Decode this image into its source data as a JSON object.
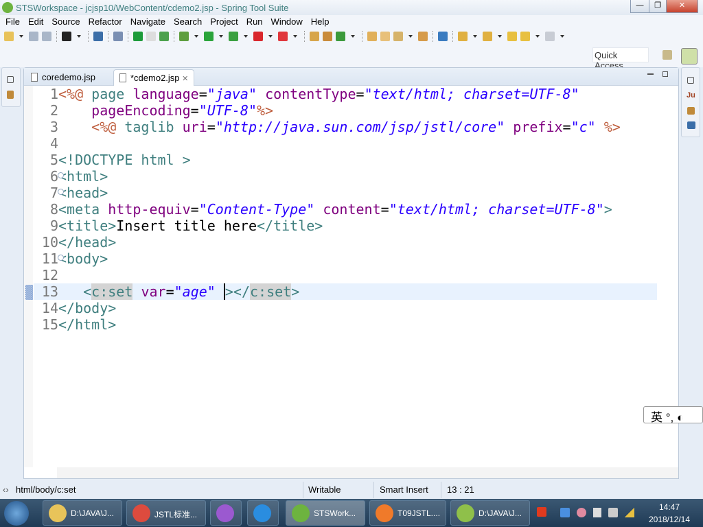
{
  "window": {
    "title": "STSWorkspace - jcjsp10/WebContent/cdemo2.jsp - Spring Tool Suite",
    "minimize": "—",
    "restore": "❐",
    "close": "✕"
  },
  "menu": [
    "File",
    "Edit",
    "Source",
    "Refactor",
    "Navigate",
    "Search",
    "Project",
    "Run",
    "Window",
    "Help"
  ],
  "toolbar": {
    "icons": [
      {
        "name": "new-icon",
        "color": "#e8c25a",
        "dd": true
      },
      {
        "name": "save-icon",
        "color": "#a9b6c8"
      },
      {
        "name": "save-all-icon",
        "color": "#a9b6c8",
        "sep": true
      },
      {
        "name": "profile-icon",
        "color": "#222",
        "dd": true,
        "sep": true
      },
      {
        "name": "terminal-icon",
        "color": "#3b6ea8",
        "sep": true
      },
      {
        "name": "skip-breakpoints-icon",
        "color": "#7a8fb3",
        "sep": true
      },
      {
        "name": "spring-boot-icon",
        "color": "#1d9b3a"
      },
      {
        "name": "toggle-icon",
        "color": "#ddd"
      },
      {
        "name": "spring-dashboard-icon",
        "color": "#4ca14c",
        "sep": true
      },
      {
        "name": "debug-icon",
        "color": "#5e9e3e",
        "dd": true
      },
      {
        "name": "run-icon",
        "color": "#2aa43a",
        "dd": true
      },
      {
        "name": "run-server-icon",
        "color": "#3aa040",
        "dd": true
      },
      {
        "name": "stop-icon",
        "color": "#d9262c",
        "dd": true
      },
      {
        "name": "external-tools-icon",
        "color": "#e0363c",
        "dd": true,
        "sep": true
      },
      {
        "name": "new-aspect-icon",
        "color": "#d7a54a"
      },
      {
        "name": "new-type-icon",
        "color": "#c98b3a"
      },
      {
        "name": "new-class-icon",
        "color": "#3b9a3b",
        "dd": true,
        "sep": true
      },
      {
        "name": "open-project-icon",
        "color": "#e1b05a"
      },
      {
        "name": "open-folder-icon",
        "color": "#e8c07a"
      },
      {
        "name": "pen-icon",
        "color": "#d6b36a",
        "dd": true
      },
      {
        "name": "open-resource-icon",
        "color": "#d69b4a",
        "sep": true
      },
      {
        "name": "globe-icon",
        "color": "#3a7bc0",
        "sep": true
      },
      {
        "name": "next-annotation-icon",
        "color": "#e0b040",
        "dd": true
      },
      {
        "name": "prev-annotation-icon",
        "color": "#e0b040",
        "dd": true
      },
      {
        "name": "last-edit-icon",
        "color": "#e8c040"
      },
      {
        "name": "back-icon",
        "color": "#e8c040",
        "dd": true
      },
      {
        "name": "forward-icon",
        "color": "#c8ccd4",
        "dd": true
      }
    ]
  },
  "quick_access": {
    "placeholder": "Quick Access"
  },
  "editor": {
    "tabs": [
      {
        "label": "coredemo.jsp",
        "active": false
      },
      {
        "label": "*cdemo2.jsp",
        "active": true,
        "close": "✕"
      }
    ],
    "current_line": 13,
    "lines": [
      {
        "n": "1",
        "tokens": [
          [
            "j",
            "<%@ "
          ],
          [
            "t",
            "page "
          ],
          [
            "a",
            "language"
          ],
          [
            "x",
            "="
          ],
          [
            "v",
            "\"java\""
          ],
          [
            "x",
            " "
          ],
          [
            "a",
            "contentType"
          ],
          [
            "x",
            "="
          ],
          [
            "v",
            "\"text/html; charset=UTF-8\""
          ]
        ]
      },
      {
        "n": "2",
        "tokens": [
          [
            "x",
            "    "
          ],
          [
            "a",
            "pageEncoding"
          ],
          [
            "x",
            "="
          ],
          [
            "v",
            "\"UTF-8\""
          ],
          [
            "j",
            "%>"
          ]
        ]
      },
      {
        "n": "3",
        "tokens": [
          [
            "x",
            "    "
          ],
          [
            "j",
            "<%@ "
          ],
          [
            "t",
            "taglib "
          ],
          [
            "a",
            "uri"
          ],
          [
            "x",
            "="
          ],
          [
            "v",
            "\"http://java.sun.com/jsp/jstl/core\""
          ],
          [
            "x",
            " "
          ],
          [
            "a",
            "prefix"
          ],
          [
            "x",
            "="
          ],
          [
            "v",
            "\"c\""
          ],
          [
            "x",
            " "
          ],
          [
            "j",
            "%>"
          ]
        ]
      },
      {
        "n": "4",
        "tokens": []
      },
      {
        "n": "5",
        "tokens": [
          [
            "t",
            "<!DOCTYPE html >"
          ]
        ]
      },
      {
        "n": "6",
        "fold": true,
        "tokens": [
          [
            "t",
            "<html>"
          ]
        ]
      },
      {
        "n": "7",
        "fold": true,
        "tokens": [
          [
            "t",
            "<head>"
          ]
        ]
      },
      {
        "n": "8",
        "tokens": [
          [
            "t",
            "<meta "
          ],
          [
            "a",
            "http-equiv"
          ],
          [
            "x",
            "="
          ],
          [
            "v",
            "\"Content-Type\""
          ],
          [
            "x",
            " "
          ],
          [
            "a",
            "content"
          ],
          [
            "x",
            "="
          ],
          [
            "v",
            "\"text/html; charset=UTF-8\""
          ],
          [
            "t",
            ">"
          ]
        ]
      },
      {
        "n": "9",
        "tokens": [
          [
            "t",
            "<title>"
          ],
          [
            "x",
            "Insert title here"
          ],
          [
            "t",
            "</title>"
          ]
        ]
      },
      {
        "n": "10",
        "tokens": [
          [
            "t",
            "</head>"
          ]
        ]
      },
      {
        "n": "11",
        "fold": true,
        "tokens": [
          [
            "t",
            "<body>"
          ]
        ]
      },
      {
        "n": "12",
        "tokens": []
      },
      {
        "n": "13",
        "tokens": [
          [
            "x",
            "   "
          ],
          [
            "t",
            "<"
          ],
          [
            "g",
            "c:set"
          ],
          [
            "x",
            " "
          ],
          [
            "a",
            "var"
          ],
          [
            "x",
            "="
          ],
          [
            "v",
            "\"age\""
          ],
          [
            "x",
            " "
          ],
          [
            "caret",
            ""
          ],
          [
            "t",
            "></"
          ],
          [
            "g",
            "c:set"
          ],
          [
            "t",
            ">"
          ]
        ]
      },
      {
        "n": "14",
        "tokens": [
          [
            "t",
            "</body>"
          ]
        ]
      },
      {
        "n": "15",
        "tokens": [
          [
            "t",
            "</html>"
          ]
        ]
      }
    ]
  },
  "status": {
    "breadcrumb": "html/body/c:set",
    "writable": "Writable",
    "insert_mode": "Smart Insert",
    "position": "13 : 21"
  },
  "taskbar": {
    "items": [
      {
        "label": "D:\\JAVA\\J...",
        "icon": "folder-icon",
        "color": "#e8c45a"
      },
      {
        "label": "JSTL标准...",
        "icon": "chrome-icon",
        "color": "#dd4b3e"
      },
      {
        "label": "",
        "icon": "pinwheel-icon",
        "color": "#9b59d0"
      },
      {
        "label": "",
        "icon": "dingtalk-icon",
        "color": "#2a8de0"
      },
      {
        "label": "STSWork...",
        "icon": "spring-icon",
        "color": "#6db33f",
        "active": true
      },
      {
        "label": "T09JSTL....",
        "icon": "presentation-icon",
        "color": "#f07a2a"
      },
      {
        "label": "D:\\JAVA\\J...",
        "icon": "notepad-icon",
        "color": "#8fc04a"
      }
    ],
    "time": "14:47",
    "date": "2018/12/14"
  },
  "ime": {
    "label": "英 °, ◐"
  }
}
